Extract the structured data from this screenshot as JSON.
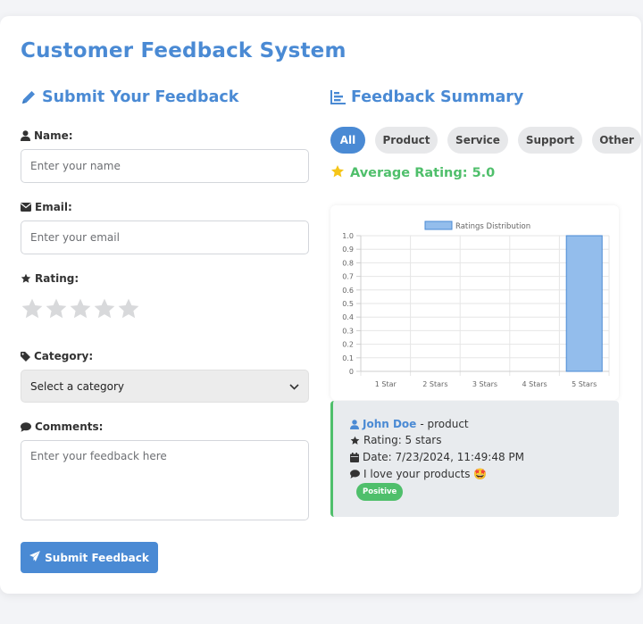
{
  "app": {
    "title": "Customer Feedback System"
  },
  "form": {
    "section_title": "Submit Your Feedback",
    "name_label": "Name:",
    "name_placeholder": "Enter your name",
    "email_label": "Email:",
    "email_placeholder": "Enter your email",
    "rating_label": "Rating:",
    "rating_value": 0,
    "rating_max": 5,
    "category_label": "Category:",
    "category_selected": "Select a category",
    "comments_label": "Comments:",
    "comments_placeholder": "Enter your feedback here",
    "submit_label": "Submit Feedback"
  },
  "summary": {
    "section_title": "Feedback Summary",
    "filters": [
      "All",
      "Product",
      "Service",
      "Support",
      "Other"
    ],
    "active_filter": "All",
    "average_text": "Average Rating: 5.0"
  },
  "chart_data": {
    "type": "bar",
    "legend": "Ratings Distribution",
    "legend_position": "top",
    "categories": [
      "1 Star",
      "2 Stars",
      "3 Stars",
      "4 Stars",
      "5 Stars"
    ],
    "values": [
      0,
      0,
      0,
      0,
      1
    ],
    "ylim": [
      0,
      1
    ],
    "yticks": [
      "0",
      "0.1",
      "0.2",
      "0.3",
      "0.4",
      "0.5",
      "0.6",
      "0.7",
      "0.8",
      "0.9",
      "1.0"
    ],
    "grid": true,
    "bar_color": "#93bdec",
    "bar_border": "#4a8ad4"
  },
  "entries": [
    {
      "name": "John Doe",
      "category_text": " - product",
      "rating_text": "Rating: 5 stars",
      "date_text": "Date: 7/23/2024, 11:49:48 PM",
      "comment_text": "I love your products 🤩",
      "sentiment": "Positive"
    }
  ],
  "colors": {
    "accent": "#4a8ad4",
    "positive": "#4fbf6b",
    "star_empty": "#d8d9db",
    "star_gold": "#f5c518"
  },
  "icons": {
    "form_title": "pencil-icon",
    "summary_title": "bar-chart-icon",
    "name": "user-icon",
    "email": "envelope-icon",
    "rating": "star-icon",
    "category": "tag-icon",
    "comments": "comment-icon",
    "submit": "paper-plane-icon"
  }
}
